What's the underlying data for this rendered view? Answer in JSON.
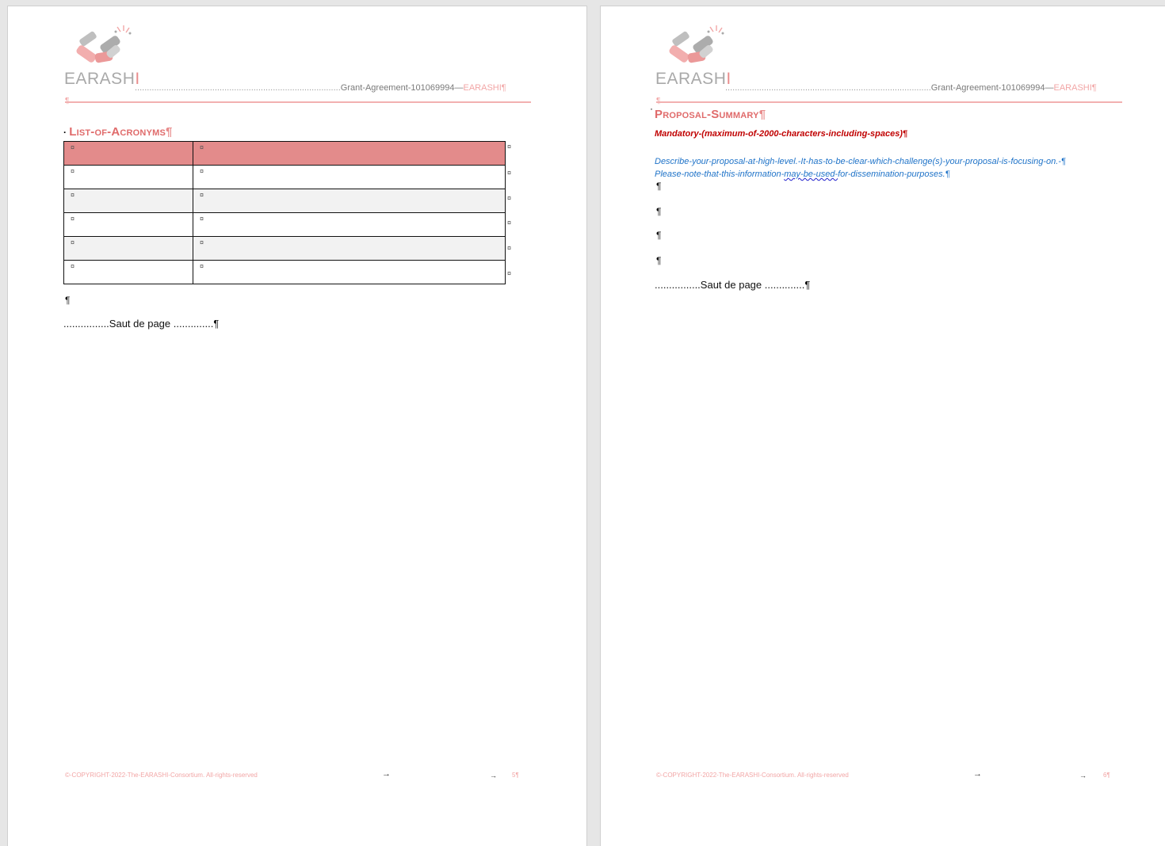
{
  "header": {
    "logo_text_grey": "EARASH",
    "logo_text_red": "I",
    "grant_agreement": "Grant-Agreement-101069994—",
    "project": "EARASHI¶"
  },
  "left_page": {
    "heading": "List-of-Acronyms",
    "heading_mark": "¶",
    "table": {
      "rows": [
        {
          "style": "head",
          "c1": "¤",
          "c2": "¤",
          "end": "¤"
        },
        {
          "style": "plain",
          "c1": "¤",
          "c2": "¤",
          "end": "¤"
        },
        {
          "style": "alt",
          "c1": "¤",
          "c2": "¤",
          "end": "¤"
        },
        {
          "style": "plain",
          "c1": "¤",
          "c2": "¤",
          "end": "¤"
        },
        {
          "style": "alt",
          "c1": "¤",
          "c2": "¤",
          "end": "¤"
        },
        {
          "style": "plain",
          "c1": "¤",
          "c2": "¤",
          "end": "¤"
        }
      ]
    },
    "after_table_mark": "¶",
    "page_break_label": "Saut de page",
    "page_break_end": "¶",
    "page_number": "5¶"
  },
  "right_page": {
    "heading": "Proposal-Summary",
    "heading_mark": "¶",
    "mandatory": "Mandatory-(maximum-of-2000-characters-including-spaces)¶",
    "describe_line1": "Describe-your-proposal-at-high-level.-It-has-to-be-clear-which-challenge(s)-your-proposal-is-focusing-on.-¶",
    "describe_line2_a": "Please-note-that-this-information-",
    "describe_line2_b": "may-be-used-",
    "describe_line2_c": "for-dissemination-purposes.",
    "describe_line2_mark": "¶",
    "empty_paragraphs": [
      "¶",
      "¶",
      "¶",
      "¶"
    ],
    "page_break_label": "Saut de page",
    "page_break_end": "¶",
    "page_number": "6¶"
  },
  "footer": {
    "copyright": "©-COPYRIGHT-2022-The-EARASHI-Consortium. All-rights-reserved",
    "arrow": "→"
  }
}
